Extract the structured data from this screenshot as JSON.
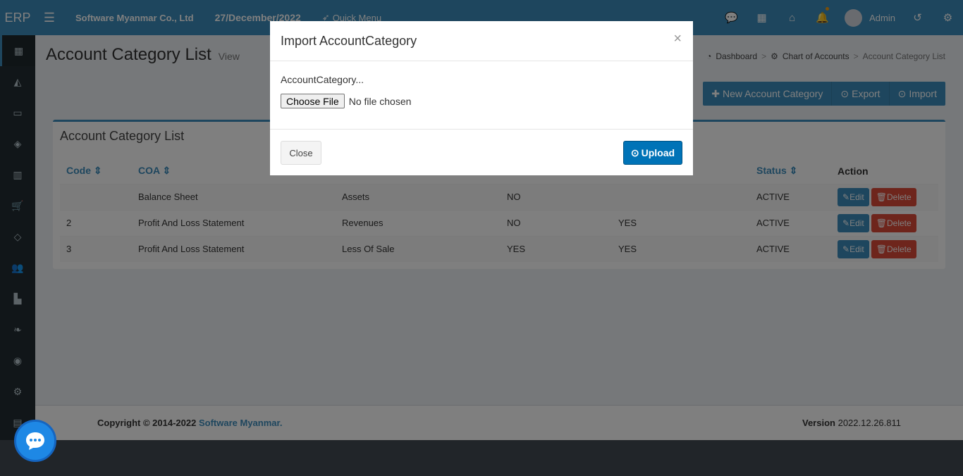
{
  "header": {
    "logo": "ERP",
    "company": "Software Myanmar Co., Ltd",
    "date": "27/December/2022",
    "quick_menu": "Quick Menu",
    "user": "Admin"
  },
  "page": {
    "title": "Account Category List",
    "subtitle": "View"
  },
  "breadcrumb": {
    "items": [
      "Dashboard",
      "Chart of Accounts",
      "Account Category List"
    ]
  },
  "actions": {
    "new": "New Account Category",
    "export": "Export",
    "import": "Import"
  },
  "table": {
    "title": "Account Category List",
    "columns": [
      "Code",
      "COA",
      "",
      "",
      "",
      "Status",
      "Action"
    ],
    "rows": [
      {
        "code": "",
        "coa": "Balance Sheet",
        "category": "Assets",
        "c4": "NO",
        "c5": "",
        "status": "ACTIVE"
      },
      {
        "code": "2",
        "coa": "Profit And Loss Statement",
        "category": "Revenues",
        "c4": "NO",
        "c5": "YES",
        "status": "ACTIVE"
      },
      {
        "code": "3",
        "coa": "Profit And Loss Statement",
        "category": "Less Of Sale",
        "c4": "YES",
        "c5": "YES",
        "status": "ACTIVE"
      }
    ],
    "edit_label": "Edit",
    "delete_label": "Delete"
  },
  "footer": {
    "copyright": "Copyright © 2014-2022",
    "company_link": "Software Myanmar.",
    "version_label": "Version",
    "version": "2022.12.26.811"
  },
  "modal": {
    "title": "Import AccountCategory",
    "close_symbol": "×",
    "field_label": "AccountCategory...",
    "file_button": "Choose File",
    "file_status": "No file chosen",
    "close_label": "Close",
    "upload_label": "Upload"
  },
  "colors": {
    "primary": "#3c8dbc",
    "danger": "#dd4b39",
    "sidebar": "#222d32"
  }
}
